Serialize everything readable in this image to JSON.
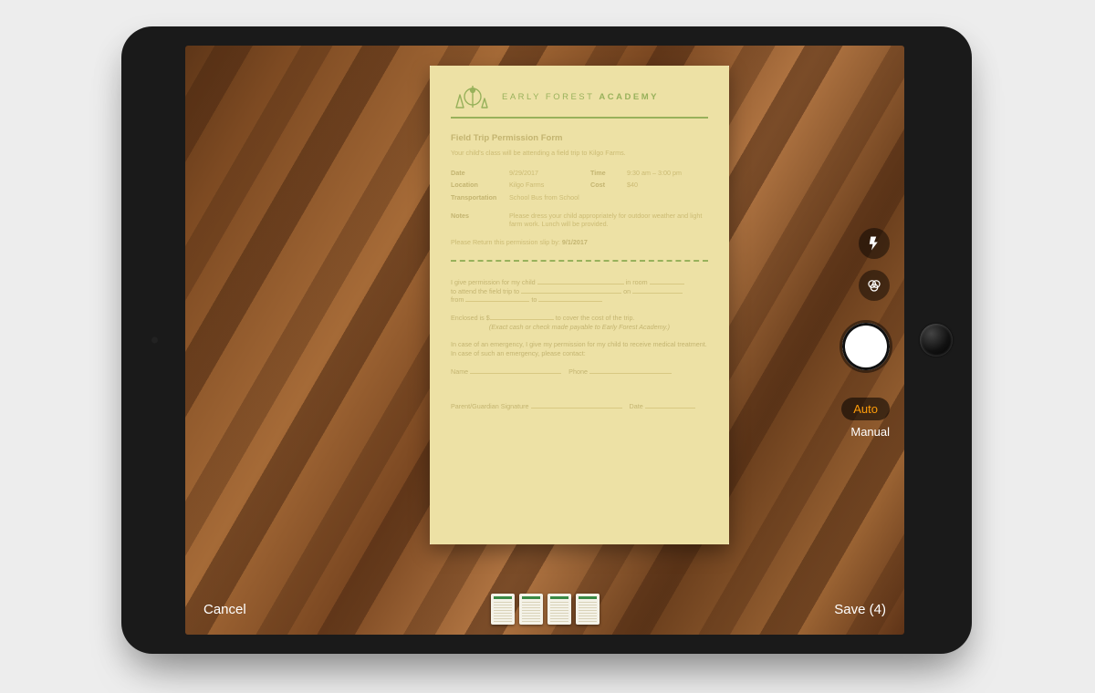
{
  "controls": {
    "cancel_label": "Cancel",
    "save_label": "Save (4)",
    "mode_auto_label": "Auto",
    "mode_manual_label": "Manual",
    "thumbnail_count": 4
  },
  "document": {
    "brand_light": "EARLY FOREST ",
    "brand_bold": "ACADEMY",
    "title": "Field Trip Permission Form",
    "subtitle": "Your child's class will be attending a field trip to Kilgo Farms.",
    "fields": {
      "date_label": "Date",
      "date_value": "9/29/2017",
      "time_label": "Time",
      "time_value": "9:30 am – 3:00 pm",
      "location_label": "Location",
      "location_value": "Kilgo Farms",
      "cost_label": "Cost",
      "cost_value": "$40",
      "transport_label": "Transportation",
      "transport_value": "School Bus from School",
      "notes_label": "Notes",
      "notes_value": "Please dress your child appropriately for outdoor weather and light farm work. Lunch will be provided."
    },
    "return_by_prefix": "Please Return this permission slip by: ",
    "return_by_date": "9/1/2017",
    "consent": {
      "line1a": "I give permission for my child ",
      "line1b": " in room ",
      "line2a": "to attend the field trip to ",
      "line2b": " on ",
      "line3a": "from ",
      "line3b": " to ",
      "enclosed_a": "Enclosed is  $",
      "enclosed_b": " to cover the cost of the trip.",
      "payable": "(Exact cash or check made payable to Early Forest Academy.)",
      "emergency": "In case of an emergency, I give my permission for my child to receive medical treatment. In case of such an emergency, please contact:",
      "name_label": "Name ",
      "phone_label": "Phone ",
      "signature_label": "Parent/Guardian Signature ",
      "sig_date_label": "Date "
    }
  }
}
